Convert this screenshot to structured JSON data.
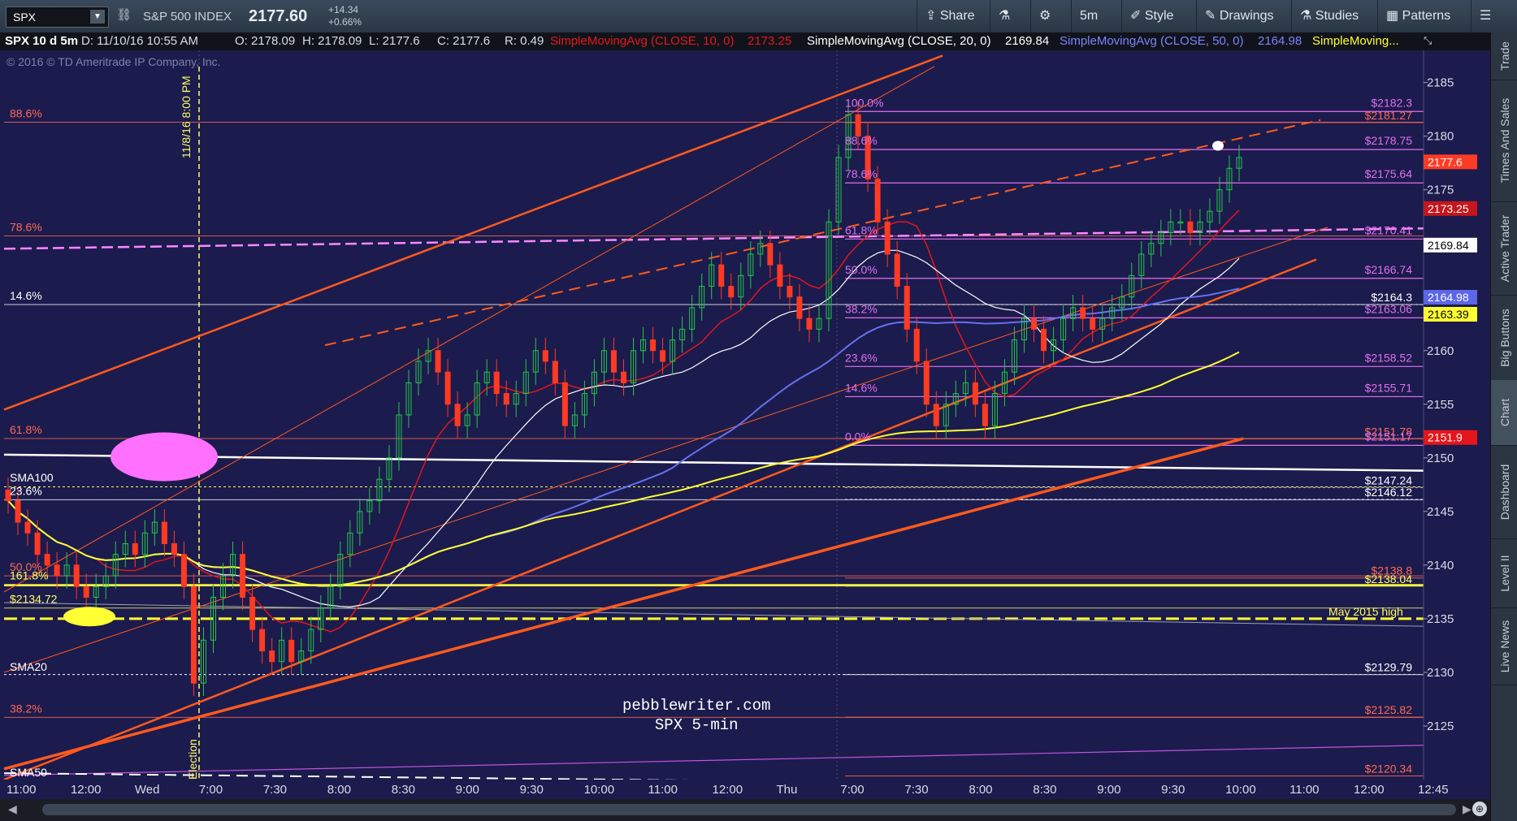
{
  "toolbar": {
    "symbol": "SPX",
    "name": "S&P 500 INDEX",
    "price": "2177.60",
    "change": "+14.34",
    "change_pct": "+0.66%",
    "share": "Share",
    "timeframe": "5m",
    "style": "Style",
    "drawings": "Drawings",
    "studies": "Studies",
    "patterns": "Patterns"
  },
  "study_bar": {
    "header": "SPX 10 d 5m",
    "date": "D: 11/10/16 10:55 AM",
    "open": "O: 2178.09",
    "high": "H: 2178.09",
    "low": "L: 2177.6",
    "close": "C: 2177.6",
    "range": "R: 0.49",
    "sma10": "SimpleMovingAvg (CLOSE, 10, 0)",
    "sma10_val": "2173.25",
    "sma20": "SimpleMovingAvg (CLOSE, 20, 0)",
    "sma20_val": "2169.84",
    "sma50": "SimpleMovingAvg (CLOSE, 50, 0)",
    "sma50_val": "2164.98",
    "sma_more": "SimpleMoving..."
  },
  "copyright": "© 2016 © TD Ameritrade IP Company, Inc.",
  "right_tabs": [
    "Trade",
    "Times And Sales",
    "Active Trader",
    "Big Buttons",
    "Chart",
    "Dashboard",
    "Level II",
    "Live News"
  ],
  "watermark": {
    "line1": "pebblewriter.com",
    "line2": "SPX 5-min"
  },
  "annotations": {
    "election_time": "11/8/16 8:00 PM",
    "election": "Election",
    "may_high": "May 2015 high",
    "sma100": "SMA100",
    "sma20": "SMA20",
    "sma50": "SMA50"
  },
  "left_levels": [
    {
      "label": "88.6%",
      "price": 2181.3,
      "color": "#ff6a55"
    },
    {
      "label": "78.6%",
      "price": 2170.7,
      "color": "#ff6a55"
    },
    {
      "label": "14.6%",
      "price": 2164.3,
      "color": "#ffffff"
    },
    {
      "label": "61.8%",
      "price": 2151.8,
      "color": "#ff6a55"
    },
    {
      "label": "23.6%",
      "price": 2146.1,
      "color": "#ffffff"
    },
    {
      "label": "50.0%",
      "price": 2139.0,
      "color": "#ff6a55"
    },
    {
      "label": "161.8%",
      "price": 2138.2,
      "color": "#ffff66"
    },
    {
      "label": "$2134.72",
      "price": 2136.0,
      "color": "#ffff66"
    },
    {
      "label": "38.2%",
      "price": 2125.8,
      "color": "#ff6a55"
    }
  ],
  "fib_levels": [
    {
      "label": "100.0%",
      "value": "$2182.3",
      "price": 2182.3
    },
    {
      "label": "88.6%",
      "value": "$2178.75",
      "price": 2178.75
    },
    {
      "label": "78.6%",
      "value": "$2175.64",
      "price": 2175.64
    },
    {
      "label": "61.8%",
      "value": "$2170.41",
      "price": 2170.41
    },
    {
      "label": "50.0%",
      "value": "$2166.74",
      "price": 2166.74
    },
    {
      "label": "38.2%",
      "value": "$2163.06",
      "price": 2163.06
    },
    {
      "label": "23.6%",
      "value": "$2158.52",
      "price": 2158.52
    },
    {
      "label": "14.6%",
      "value": "$2155.71",
      "price": 2155.71
    },
    {
      "label": "0.0%",
      "value": "$2151.17",
      "price": 2151.17
    }
  ],
  "right_levels": [
    {
      "value": "$2181.27",
      "price": 2181.27,
      "color": "#ff6a55"
    },
    {
      "value": "$2151.78",
      "price": 2151.78,
      "color": "#ff6a55"
    },
    {
      "value": "$2164.3",
      "price": 2164.3,
      "color": "#ffffff"
    },
    {
      "value": "$2147.24",
      "price": 2147.24,
      "color": "#ffffff"
    },
    {
      "value": "$2146.12",
      "price": 2146.12,
      "color": "#ffffff"
    },
    {
      "value": "$2138.8",
      "price": 2138.8,
      "color": "#ff6a55"
    },
    {
      "value": "$2138.04",
      "price": 2138.04,
      "color": "#ffff66"
    },
    {
      "value": "$2129.79",
      "price": 2129.79,
      "color": "#ffffff"
    },
    {
      "value": "$2125.82",
      "price": 2125.82,
      "color": "#ff6a55"
    },
    {
      "value": "$2120.34",
      "price": 2120.34,
      "color": "#ff6a55"
    }
  ],
  "price_badges": [
    {
      "value": "2177.6",
      "price": 2177.6,
      "bg": "#ff3b24",
      "fg": "#ffffff"
    },
    {
      "value": "2173.25",
      "price": 2173.25,
      "bg": "#c4161c",
      "fg": "#ffffff"
    },
    {
      "value": "2169.84",
      "price": 2169.84,
      "bg": "#ffffff",
      "fg": "#000000"
    },
    {
      "value": "2164.98",
      "price": 2164.98,
      "bg": "#5b67e6",
      "fg": "#ffffff"
    },
    {
      "value": "2163.39",
      "price": 2163.39,
      "bg": "#ffff33",
      "fg": "#000000"
    },
    {
      "value": "2151.9",
      "price": 2151.9,
      "bg": "#e4161c",
      "fg": "#ffffff"
    }
  ],
  "chart_data": {
    "type": "candlestick",
    "symbol": "SPX",
    "interval": "5m",
    "y_ticks": [
      2125,
      2130,
      2135,
      2140,
      2145,
      2150,
      2155,
      2160,
      2165,
      2170,
      2175,
      2180,
      2185
    ],
    "ylim": [
      2120,
      2188
    ],
    "x_ticks": [
      "11:00",
      "12:00",
      "Wed",
      "7:00",
      "7:30",
      "8:00",
      "8:30",
      "9:00",
      "9:30",
      "10:00",
      "11:00",
      "12:00",
      "Thu",
      "7:00",
      "7:30",
      "8:00",
      "8:30",
      "9:00",
      "9:30",
      "10:00",
      "11:00",
      "12:00",
      "12:45"
    ],
    "closes": [
      2146,
      2144,
      2143,
      2141,
      2140,
      2139,
      2140,
      2138,
      2137,
      2138,
      2139,
      2141,
      2142,
      2141,
      2143,
      2144,
      2142,
      2141,
      2138,
      2129,
      2133,
      2137,
      2139,
      2141,
      2137,
      2134,
      2132,
      2131,
      2133,
      2131,
      2132,
      2134,
      2136,
      2138,
      2141,
      2143,
      2145,
      2146,
      2148,
      2150,
      2154,
      2157,
      2159,
      2160,
      2158,
      2155,
      2153,
      2154,
      2157,
      2158,
      2156,
      2155,
      2156,
      2158,
      2160,
      2159,
      2157,
      2153,
      2154,
      2156,
      2158,
      2160,
      2158,
      2157,
      2160,
      2161,
      2160,
      2159,
      2161,
      2162,
      2164,
      2166,
      2168,
      2166,
      2165,
      2167,
      2169,
      2170,
      2168,
      2166,
      2165,
      2163,
      2162,
      2163,
      2172,
      2178,
      2182,
      2180,
      2176,
      2172,
      2169,
      2166,
      2162,
      2159,
      2155,
      2153,
      2155,
      2156,
      2157,
      2155,
      2153,
      2156,
      2158,
      2161,
      2163,
      2162,
      2160,
      2161,
      2163,
      2164,
      2163,
      2162,
      2163,
      2164,
      2165,
      2167,
      2169,
      2170,
      2171,
      2172,
      2172,
      2171,
      2172,
      2173,
      2175,
      2177,
      2178
    ],
    "series": [
      {
        "name": "SimpleMovingAvg (CLOSE, 10, 0)",
        "last": 2173.25,
        "color": "#e4161c"
      },
      {
        "name": "SimpleMovingAvg (CLOSE, 20, 0)",
        "last": 2169.84,
        "color": "#ffffff"
      },
      {
        "name": "SimpleMovingAvg (CLOSE, 50, 0)",
        "last": 2164.98,
        "color": "#6570f0"
      },
      {
        "name": "SimpleMoving...",
        "last": 2163.39,
        "color": "#ffff33"
      }
    ]
  }
}
